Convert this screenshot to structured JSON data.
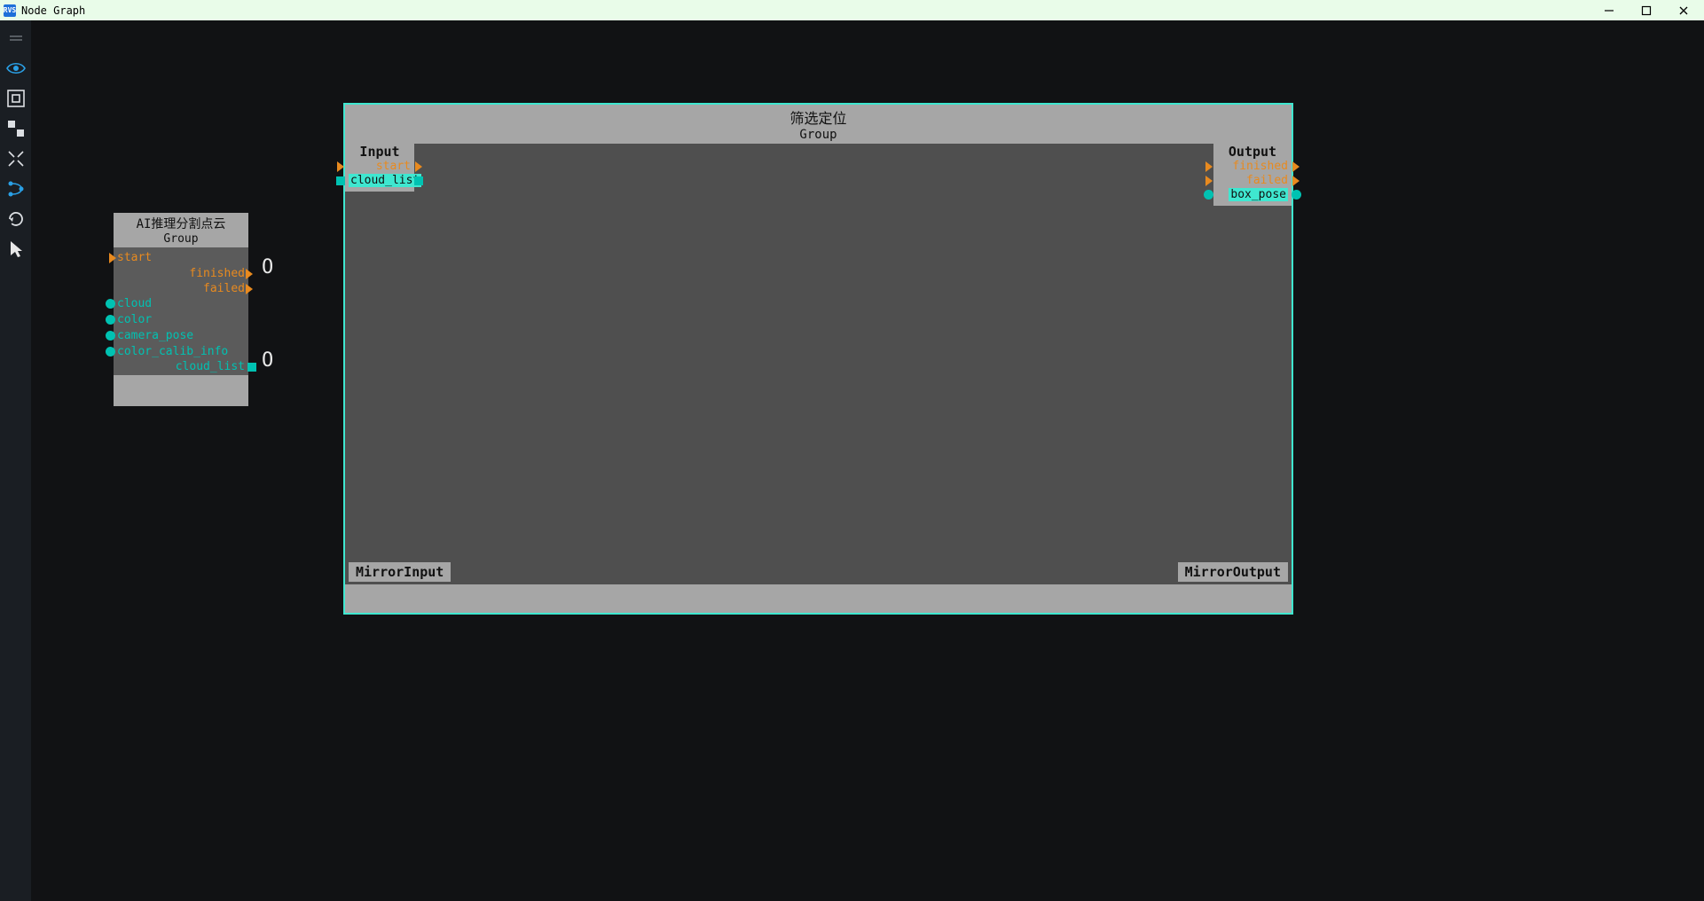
{
  "window": {
    "title": "Node Graph",
    "app_icon_text": "RVS"
  },
  "toolbar": {
    "icons": [
      "eye",
      "frame",
      "nodes",
      "collapse",
      "branch",
      "refresh",
      "cursor"
    ]
  },
  "ai_node": {
    "title": "AI推理分割点云",
    "subtitle": "Group",
    "inputs": {
      "start": "start",
      "cloud": "cloud",
      "color": "color",
      "camera_pose": "camera_pose",
      "color_calib_info": "color_calib_info"
    },
    "outputs": {
      "finished": "finished",
      "failed": "failed",
      "cloud_list": "cloud_list"
    },
    "counts": {
      "finished": "O",
      "cloud_list": "O"
    }
  },
  "group_node": {
    "title": "筛选定位",
    "subtitle": "Group",
    "input_block": {
      "label": "Input",
      "start": "start",
      "cloud_list": "cloud_list"
    },
    "output_block": {
      "label": "Output",
      "finished": "finished",
      "failed": "failed",
      "box_pose": "box_pose"
    },
    "mirror_input": "MirrorInput",
    "mirror_output": "MirrorOutput"
  }
}
